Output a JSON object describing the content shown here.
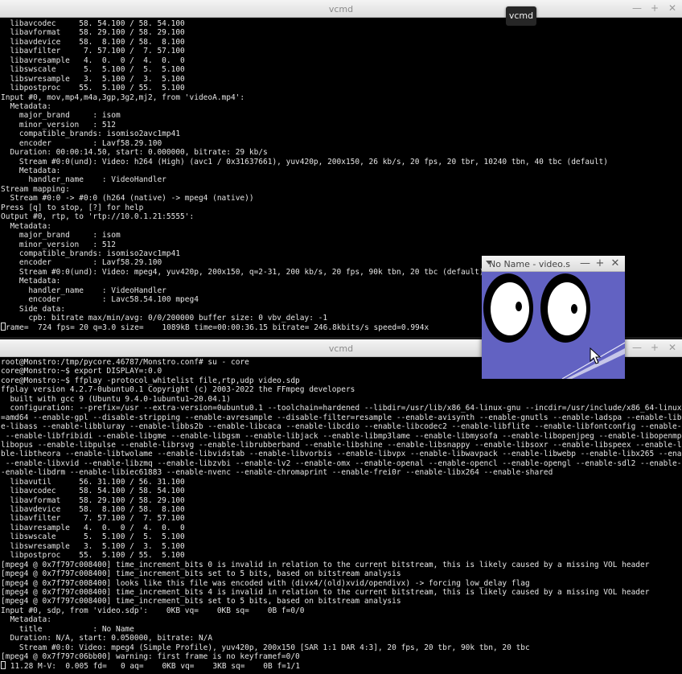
{
  "windows": {
    "top": {
      "title": "vcmd",
      "lines": [
        "  libavcodec     58. 54.100 / 58. 54.100",
        "  libavformat    58. 29.100 / 58. 29.100",
        "  libavdevice    58.  8.100 / 58.  8.100",
        "  libavfilter     7. 57.100 /  7. 57.100",
        "  libavresample   4.  0.  0 /  4.  0.  0",
        "  libswscale      5.  5.100 /  5.  5.100",
        "  libswresample   3.  5.100 /  3.  5.100",
        "  libpostproc    55.  5.100 / 55.  5.100",
        "Input #0, mov,mp4,m4a,3gp,3g2,mj2, from 'videoA.mp4':",
        "  Metadata:",
        "    major_brand     : isom",
        "    minor_version   : 512",
        "    compatible_brands: isomiso2avc1mp41",
        "    encoder         : Lavf58.29.100",
        "  Duration: 00:00:14.50, start: 0.000000, bitrate: 29 kb/s",
        "    Stream #0:0(und): Video: h264 (High) (avc1 / 0x31637661), yuv420p, 200x150, 26 kb/s, 20 fps, 20 tbr, 10240 tbn, 40 tbc (default)",
        "    Metadata:",
        "      handler_name    : VideoHandler",
        "Stream mapping:",
        "  Stream #0:0 -> #0:0 (h264 (native) -> mpeg4 (native))",
        "Press [q] to stop, [?] for help",
        "Output #0, rtp, to 'rtp://10.0.1.21:5555':",
        "  Metadata:",
        "    major_brand     : isom",
        "    minor_version   : 512",
        "    compatible_brands: isomiso2avc1mp41",
        "    encoder         : Lavf58.29.100",
        "    Stream #0:0(und): Video: mpeg4, yuv420p, 200x150, q=2-31, 200 kb/s, 20 fps, 90k tbn, 20 tbc (default)",
        "    Metadata:",
        "      handler_name    : VideoHandler",
        "      encoder         : Lavc58.54.100 mpeg4",
        "    Side data:",
        "      cpb: bitrate max/min/avg: 0/0/200000 buffer size: 0 vbv_delay: -1"
      ],
      "status_line": "rame=  724 fps= 20 q=3.0 size=    1089kB time=00:00:36.15 bitrate= 246.8kbits/s speed=0.994x"
    },
    "bottom": {
      "title": "vcmd",
      "lines": [
        "root@Monstro:/tmp/pycore.46787/Monstro.conf# su - core",
        "core@Monstro:~$ export DISPLAY=:0.0",
        "core@Monstro:~$ ffplay -protocol_whitelist file,rtp,udp video.sdp",
        "ffplay version 4.2.7-0ubuntu0.1 Copyright (c) 2003-2022 the FFmpeg developers",
        "  built with gcc 9 (Ubuntu 9.4.0-1ubuntu1~20.04.1)",
        "  configuration: --prefix=/usr --extra-version=0ubuntu0.1 --toolchain=hardened --libdir=/usr/lib/x86_64-linux-gnu --incdir=/usr/include/x86_64-linux-gnu --arch",
        "=amd64 --enable-gpl --disable-stripping --enable-avresample --disable-filter=resample --enable-avisynth --enable-gnutls --enable-ladspa --enable-libaom --enabl",
        "e-libass --enable-libbluray --enable-libbs2b --enable-libcaca --enable-libcdio --enable-libcodec2 --enable-libflite --enable-libfontconfig --enable-libfreetype",
        " --enable-libfribidi --enable-libgme --enable-libgsm --enable-libjack --enable-libmp3lame --enable-libmysofa --enable-libopenjpeg --enable-libopenmpt --enable-",
        "libopus --enable-libpulse --enable-librsvg --enable-librubberband --enable-libshine --enable-libsnappy --enable-libsoxr --enable-libspeex --enable-libssh --ena",
        "ble-libtheora --enable-libtwolame --enable-libvidstab --enable-libvorbis --enable-libvpx --enable-libwavpack --enable-libwebp --enable-libx265 --enable-libxml2",
        " --enable-libxvid --enable-libzmq --enable-libzvbi --enable-lv2 --enable-omx --enable-openal --enable-opencl --enable-opengl --enable-sdl2 --enable-libdc1394 -",
        "-enable-libdrm --enable-libiec61883 --enable-nvenc --enable-chromaprint --enable-frei0r --enable-libx264 --enable-shared",
        "  libavutil      56. 31.100 / 56. 31.100",
        "  libavcodec     58. 54.100 / 58. 54.100",
        "  libavformat    58. 29.100 / 58. 29.100",
        "  libavdevice    58.  8.100 / 58.  8.100",
        "  libavfilter     7. 57.100 /  7. 57.100",
        "  libavresample   4.  0.  0 /  4.  0.  0",
        "  libswscale      5.  5.100 /  5.  5.100",
        "  libswresample   3.  5.100 /  3.  5.100",
        "  libpostproc    55.  5.100 / 55.  5.100",
        "[mpeg4 @ 0x7f797c008400] time_increment_bits 0 is invalid in relation to the current bitstream, this is likely caused by a missing VOL header",
        "[mpeg4 @ 0x7f797c008400] time_increment_bits set to 5 bits, based on bitstream analysis",
        "[mpeg4 @ 0x7f797c008400] looks like this file was encoded with (divx4/(old)xvid/opendivx) -> forcing low_delay flag",
        "[mpeg4 @ 0x7f797c008400] time_increment_bits 4 is invalid in relation to the current bitstream, this is likely caused by a missing VOL header",
        "[mpeg4 @ 0x7f797c008400] time_increment_bits set to 5 bits, based on bitstream analysis",
        "Input #0, sdp, from 'video.sdp':    0KB vq=    0KB sq=    0B f=0/0",
        "  Metadata:",
        "    title           : No Name",
        "  Duration: N/A, start: 0.050000, bitrate: N/A",
        "    Stream #0:0: Video: mpeg4 (Simple Profile), yuv420p, 200x150 [SAR 1:1 DAR 4:3], 20 fps, 20 tbr, 90k tbn, 20 tbc",
        "[mpeg4 @ 0x7f797c06bb00] warning: first frame is no keyframef=0/0"
      ],
      "status_line": " 11.28 M-V:  0.005 fd=   0 aq=    0KB vq=    3KB sq=    0B f=1/1"
    }
  },
  "tooltip": {
    "text": "vcmd"
  },
  "player": {
    "title": "No Name - video.s",
    "video_bg": "#5f5fc0"
  },
  "colors": {
    "terminal_bg": "#000000",
    "terminal_fg": "#e6e6e6",
    "titlebar_bg": "#e8e8e8"
  }
}
